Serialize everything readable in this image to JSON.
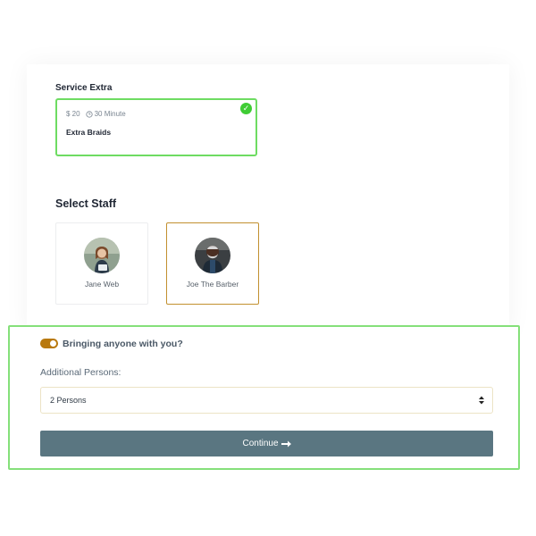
{
  "service_extra": {
    "title": "Service Extra",
    "item": {
      "price": "$ 20",
      "duration": "30 Minute",
      "name": "Extra Braids",
      "selected": true
    }
  },
  "staff": {
    "title": "Select Staff",
    "members": [
      {
        "name": "Jane Web",
        "selected": false
      },
      {
        "name": "Joe The Barber",
        "selected": true
      }
    ]
  },
  "additional": {
    "toggle_label": "Bringing anyone with you?",
    "toggle_on": true,
    "persons_label": "Additional Persons:",
    "persons_value": "2 Persons"
  },
  "continue_label": "Continue",
  "colors": {
    "selected_border": "#6edc62",
    "check_green": "#3fcc34",
    "staff_selected_border": "#c2902f",
    "toggle": "#b8790f",
    "button": "#5a7681"
  }
}
